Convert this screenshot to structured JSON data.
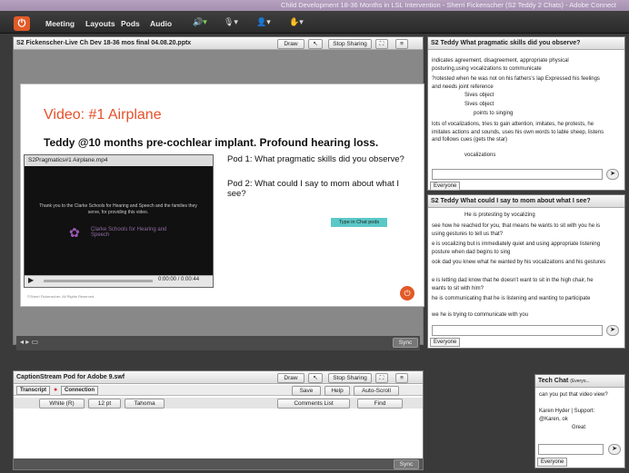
{
  "window_title": "Child Development 18-36 Months in LSL Intervention - Sherri Fickenscher (S2 Teddy 2 Chats) - Adobe Connect",
  "menu": [
    "Meeting",
    "Layouts",
    "Pods",
    "Audio"
  ],
  "share_pod": {
    "title": "S2 Fickenscher-Live Ch Dev 18-36 mos final 04.08.20.pptx",
    "draw": "Draw",
    "stop": "Stop Sharing"
  },
  "slide": {
    "title": "Video: #1 Airplane",
    "subtitle": "Teddy @10 months pre-cochlear implant. Profound hearing loss.",
    "q1": "Pod 1: What pragmatic skills did you observe?",
    "q2": "Pod 2: What could I say to mom about what I see?",
    "chat_hint": "Type in Chat pods",
    "footer": "©Sherri Fickenscher. All Rights Reserved."
  },
  "video": {
    "title": "S2Pragmatics#1 Airplane.mp4",
    "thanks": "Thank you to the Clarke Schools for Hearing and Speech and the families they serve, for providing this video.",
    "logo_text": "Clarke Schools for Hearing and Speech",
    "time": "0:00:00 / 0:00:44"
  },
  "sync": "Sync",
  "chat1": {
    "title": "S2 Teddy  What pragmatic skills did you observe?",
    "lines": [
      "indicates agreement, disagreement, appropriate physical posturing,using vocalizations to communicate",
      "?rotested when he was not on his fathers's lap Expressed his feelings and needs  joint reference",
      "Sives object",
      "Sives object",
      "points to singing",
      "lots of vocalizations, tries to gain attention, imitates, he protests, he imitates actions and sounds, uses his own words to lable sheep, listens and follows cues (gets the star)",
      "vocalizations"
    ],
    "tab": "Everyone"
  },
  "chat2": {
    "title": "S2 Teddy  What could I say to mom about what I see?",
    "lines": [
      "He is protesting by vocalizing",
      "see how he reached for you, that means he wants to sit with you  he is using gestures to tell us that?",
      "e is vocalizing but is immediately quiet and using appropriate listening posture when dad begins to sing",
      "ook dad you knew what he wanted by his vocalizations and his gestures",
      "e is letting dad know that he doesn't want to sit in the high chair, he wants to sit with him?",
      "he is communicating that he is listening and wanting to participate",
      "we he is trying to communicate with you"
    ],
    "tab": "Everyone"
  },
  "caption": {
    "title": "CaptionStream Pod for Adobe 9.swf",
    "draw": "Draw",
    "stop": "Stop Sharing",
    "tab1": "Transcript",
    "tab2": "Connection",
    "save": "Save",
    "help": "Help",
    "autoscroll": "Auto-Scroll",
    "color": "White (R)",
    "size": "12 pt",
    "font": "Tahoma",
    "comments": "Comments List",
    "find": "Find"
  },
  "tech": {
    "title": "Tech Chat",
    "title_extra": "(Everyo...",
    "lines": [
      "can you put that video view?",
      "Karen Hyder | Support: @Karen, ok",
      "Great"
    ],
    "tab": "Everyone"
  },
  "icons": [
    "power-icon",
    "speaker-icon",
    "mic-icon",
    "camera-icon",
    "user-icon",
    "menu-icon"
  ]
}
